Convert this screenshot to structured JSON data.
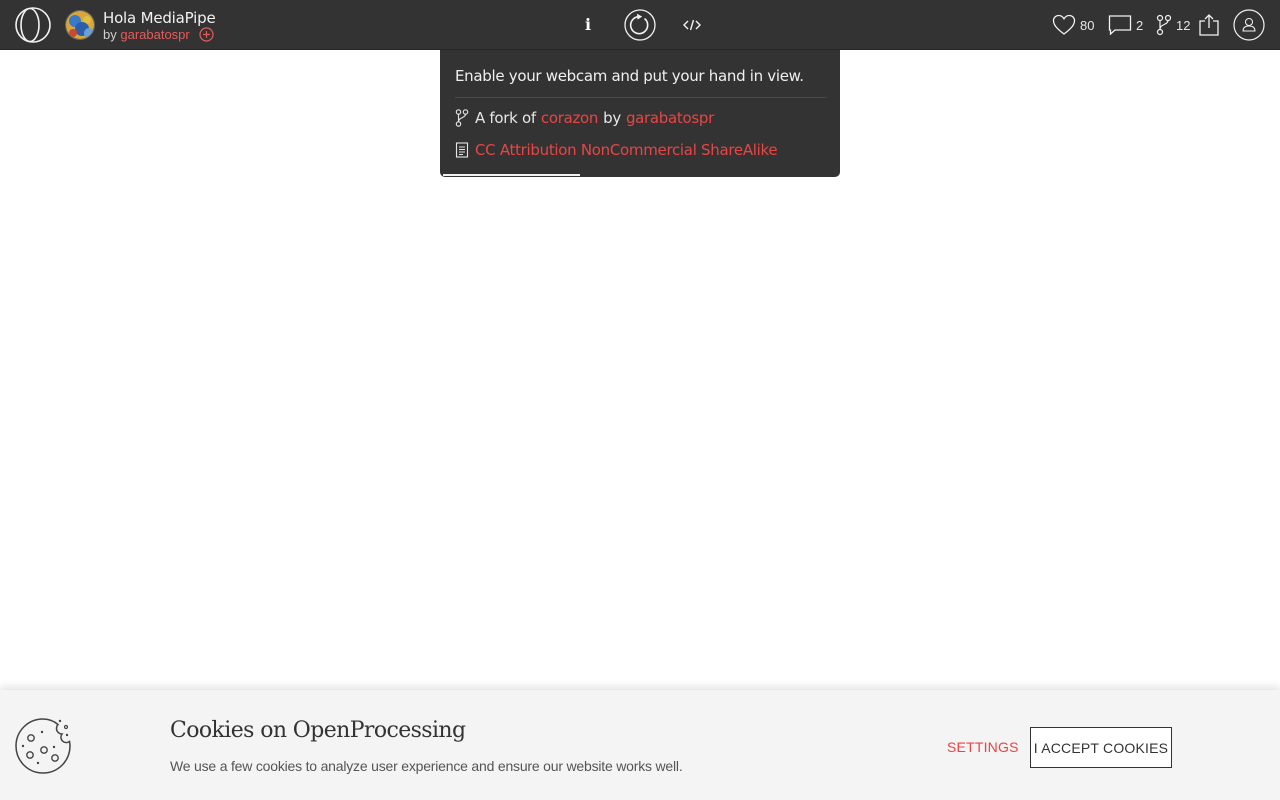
{
  "header": {
    "sketch_title": "Hola MediaPipe",
    "by_prefix": "by",
    "author": "garabatospr",
    "likes": "80",
    "comments": "2",
    "forks": "12",
    "info_label": "i"
  },
  "info_panel": {
    "description": "Enable your webcam and put your hand in view.",
    "fork_prefix": "A fork of",
    "fork_source": "corazon",
    "fork_by": "by",
    "fork_author": "garabatospr",
    "license": "CC Attribution NonCommercial ShareAlike"
  },
  "cookie_banner": {
    "title": "Cookies on OpenProcessing",
    "text": "We use a few cookies to analyze user experience and ensure our website works well.",
    "settings_label": "SETTINGS",
    "accept_label": "I ACCEPT COOKIES"
  },
  "colors": {
    "topbar": "#333333",
    "accent": "#e84545",
    "cookie_bg": "#f4f4f4"
  },
  "icons": [
    "openprocessing-logo-icon",
    "author-avatar",
    "follow-plus-icon",
    "info-icon",
    "restart-icon",
    "code-icon",
    "heart-icon",
    "comment-icon",
    "fork-icon",
    "share-icon",
    "user-icon",
    "license-document-icon",
    "cookie-icon"
  ]
}
